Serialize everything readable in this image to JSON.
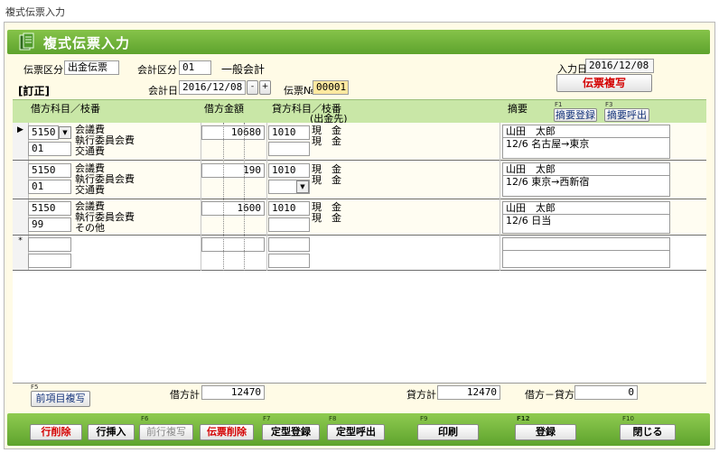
{
  "window": {
    "title": "複式伝票入力"
  },
  "header": {
    "title": "複式伝票入力"
  },
  "form": {
    "slip_type_label": "伝票区分",
    "slip_type_value": "出金伝票",
    "acct_div_label": "会計区分",
    "acct_div_code": "01",
    "acct_div_name": "一般会計",
    "correction": "[訂正]",
    "acct_date_label": "会計日",
    "acct_date_value": "2016/12/08",
    "slip_no_label": "伝票№",
    "slip_no_value": "00001",
    "input_date_label": "入力日",
    "input_date_value": "2016/12/08",
    "copy_slip_button": "伝票複写",
    "date_minus": "-",
    "date_plus": "+"
  },
  "columns": {
    "debit_account": "借方科目／枝番",
    "debit_amount": "借方金額",
    "credit_account": "貸方科目／枝番",
    "credit_sub": "(出金先)",
    "summary": "摘要",
    "summary_register": "摘要登録",
    "summary_register_fkey": "F1",
    "summary_call": "摘要呼出",
    "summary_call_fkey": "F3"
  },
  "rows": [
    {
      "debit_code": "5150",
      "debit_sub": "01",
      "debit_names": [
        "会議費",
        "執行委員会費",
        "交通費"
      ],
      "amount": "10680",
      "credit_code": "1010",
      "credit_names": "現　金\n現　金",
      "summary1": "山田　太郎",
      "summary2": "12/6 名古屋→東京"
    },
    {
      "debit_code": "5150",
      "debit_sub": "01",
      "debit_names": [
        "会議費",
        "執行委員会費",
        "交通費"
      ],
      "amount": "190",
      "credit_code": "1010",
      "credit_names": "現　金\n現　金",
      "summary1": "山田　太郎",
      "summary2": "12/6 東京→西新宿"
    },
    {
      "debit_code": "5150",
      "debit_sub": "99",
      "debit_names": [
        "会議費",
        "執行委員会費",
        "その他"
      ],
      "amount": "1600",
      "credit_code": "1010",
      "credit_names": "現　金\n現　金",
      "summary1": "山田　太郎",
      "summary2": "12/6 日当"
    }
  ],
  "new_row_marker": "*",
  "current_row_marker": "▶",
  "bottom": {
    "copy_prev_fkey": "F5",
    "copy_prev_label": "前項目複写",
    "debit_total_label": "借方計",
    "debit_total_value": "12470",
    "credit_total_label": "貸方計",
    "credit_total_value": "12470",
    "diff_label": "借方－貸方",
    "diff_value": "0"
  },
  "footer": {
    "delete_row": "行削除",
    "insert_row": "行挿入",
    "copy_prev_row_fkey": "F6",
    "copy_prev_row": "前行複写",
    "delete_slip": "伝票削除",
    "template_register_fkey": "F7",
    "template_register": "定型登録",
    "template_call_fkey": "F8",
    "template_call": "定型呼出",
    "print_fkey": "F9",
    "print": "印刷",
    "save_fkey": "F12",
    "save": "登録",
    "close_fkey": "F10",
    "close": "閉じる"
  }
}
